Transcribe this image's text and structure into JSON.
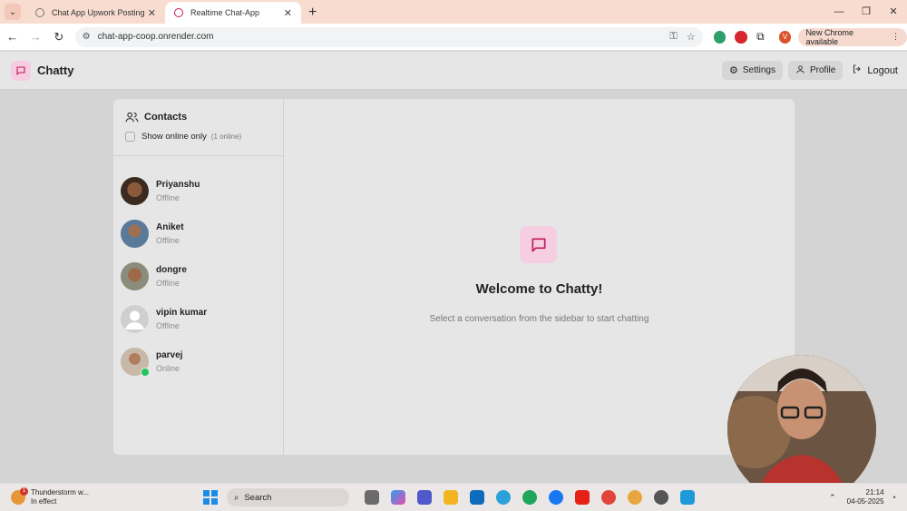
{
  "browser": {
    "tabs": [
      {
        "title": "Chat App Upwork Posting",
        "active": false
      },
      {
        "title": "Realtime Chat-App",
        "active": true
      }
    ],
    "url": "chat-app-coop.onrender.com",
    "new_chrome_label": "New Chrome available",
    "profile_initial": "V"
  },
  "app": {
    "brand": "Chatty",
    "brand_color": "#c2185b",
    "header_buttons": {
      "settings": "Settings",
      "profile": "Profile",
      "logout": "Logout"
    }
  },
  "sidebar": {
    "title": "Contacts",
    "filter_label": "Show online only",
    "online_count": "(1 online)",
    "contacts": [
      {
        "name": "Priyanshu",
        "status": "Offline",
        "online": false
      },
      {
        "name": "Aniket",
        "status": "Offline",
        "online": false
      },
      {
        "name": "dongre",
        "status": "Offline",
        "online": false
      },
      {
        "name": "vipin kumar",
        "status": "Offline",
        "online": false
      },
      {
        "name": "parvej",
        "status": "Online",
        "online": true
      }
    ]
  },
  "main": {
    "welcome_title": "Welcome to Chatty!",
    "welcome_subtitle": "Select a conversation from the sidebar to start chatting"
  },
  "taskbar": {
    "weather_title": "Thunderstorm w...",
    "weather_sub": "In effect",
    "weather_badge": "1",
    "search_label": "Search",
    "time": "21:14",
    "date": "04-05-2025"
  }
}
